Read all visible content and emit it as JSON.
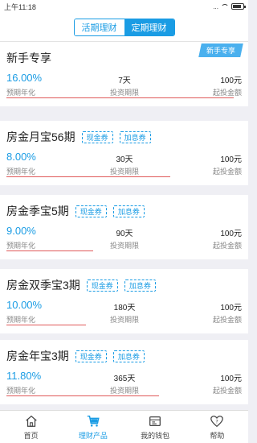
{
  "status": {
    "time": "上午11:18",
    "dots": "..."
  },
  "segments": [
    {
      "label": "活期理财",
      "active": false
    },
    {
      "label": "定期理财",
      "active": true
    }
  ],
  "products": [
    {
      "name": "新手专享",
      "ribbon": "新手专享",
      "tags": [],
      "rate": "16.00%",
      "rate_label": "预期年化",
      "term": "7天",
      "term_label": "投资期限",
      "min": "100元",
      "min_label": "起投金额",
      "progress": 1.0
    },
    {
      "name": "房金月宝56期",
      "ribbon": "",
      "tags": [
        "现金券",
        "加息券"
      ],
      "rate": "8.00%",
      "rate_label": "预期年化",
      "term": "30天",
      "term_label": "投资期限",
      "min": "100元",
      "min_label": "起投金额",
      "progress": 0.72
    },
    {
      "name": "房金季宝5期",
      "ribbon": "",
      "tags": [
        "现金券",
        "加息券"
      ],
      "rate": "9.00%",
      "rate_label": "预期年化",
      "term": "90天",
      "term_label": "投资期限",
      "min": "100元",
      "min_label": "起投金额",
      "progress": 0.38
    },
    {
      "name": "房金双季宝3期",
      "ribbon": "",
      "tags": [
        "现金券",
        "加息券"
      ],
      "rate": "10.00%",
      "rate_label": "预期年化",
      "term": "180天",
      "term_label": "投资期限",
      "min": "100元",
      "min_label": "起投金额",
      "progress": 0.35
    },
    {
      "name": "房金年宝3期",
      "ribbon": "",
      "tags": [
        "现金券",
        "加息券"
      ],
      "rate": "11.80%",
      "rate_label": "预期年化",
      "term": "365天",
      "term_label": "投资期限",
      "min": "100元",
      "min_label": "起投金额",
      "progress": 0.67
    }
  ],
  "tabs": [
    {
      "label": "首页",
      "icon": "home-icon",
      "active": false
    },
    {
      "label": "理财产品",
      "icon": "cart-icon",
      "active": true
    },
    {
      "label": "我的钱包",
      "icon": "wallet-icon",
      "active": false
    },
    {
      "label": "帮助",
      "icon": "help-icon",
      "active": false
    }
  ],
  "colors": {
    "accent": "#1a9ce4",
    "progress": "#e05a5a",
    "background": "#efeff4"
  }
}
